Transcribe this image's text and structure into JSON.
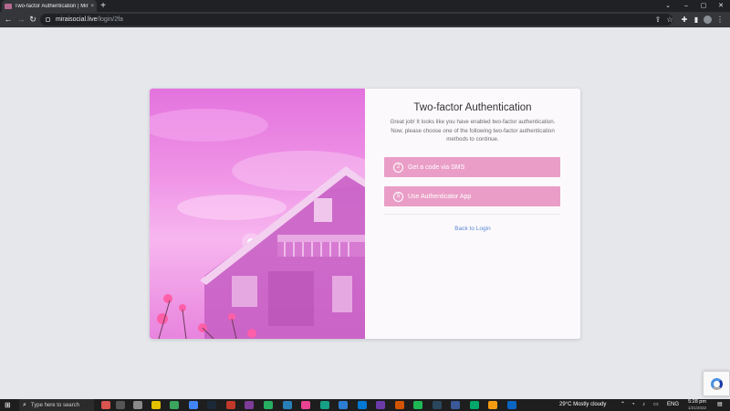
{
  "browser": {
    "tab_title": "Two-factor Authentication | Mirai",
    "tab_close": "×",
    "new_tab": "+",
    "url_host": "miraisocial.live",
    "url_path": "/login/2fa",
    "nav": {
      "back": "←",
      "forward": "→",
      "reload": "↻"
    },
    "window_controls": {
      "dropdown": "⌄",
      "minimize": "–",
      "maximize": "▢",
      "close": "✕"
    },
    "toolbar_icons": {
      "share": "⇪",
      "star": "☆",
      "extensions": "✚",
      "sidebar": "▮",
      "menu": "⋮"
    }
  },
  "auth": {
    "title": "Two-factor Authentication",
    "description": "Great job! It looks like you have enabled two-factor authentication. Now, please choose one of the following two-factor authentication methods to continue.",
    "methods": [
      {
        "label": "Get a code via SMS",
        "icon": "sms-chat-icon",
        "glyph": "2"
      },
      {
        "label": "Use Authenticator App",
        "icon": "authenticator-app-icon",
        "glyph": "S"
      }
    ],
    "back_link": "Back to Login",
    "button_color": "#ea9ec7",
    "link_color": "#5a8ad4"
  },
  "taskbar": {
    "start_glyph": "⊞",
    "search_glyph": "⌕",
    "search_placeholder": "Type here to search",
    "weather": "29°C  Mostly cloudy",
    "language": "ENG",
    "time": "5:28 pm",
    "date": "1/21/2022"
  }
}
